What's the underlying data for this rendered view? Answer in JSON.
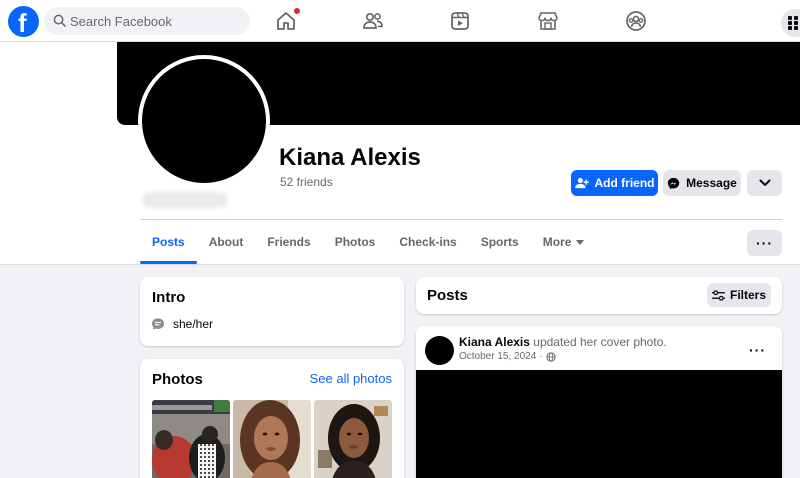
{
  "nav": {
    "logo": "f",
    "search_placeholder": "Search Facebook",
    "icons": [
      "home-icon",
      "friends-icon",
      "watch-icon",
      "marketplace-icon",
      "groups-icon",
      "menu-grid-icon"
    ],
    "notification_color": "#e41e3f"
  },
  "profile": {
    "name": "Kiana Alexis",
    "friends": "52 friends",
    "add_friend": "Add friend",
    "message": "Message"
  },
  "tabs": [
    {
      "label": "Posts",
      "active": true
    },
    {
      "label": "About"
    },
    {
      "label": "Friends"
    },
    {
      "label": "Photos"
    },
    {
      "label": "Check-ins"
    },
    {
      "label": "Sports"
    },
    {
      "label": "More"
    }
  ],
  "intro": {
    "title": "Intro",
    "pronouns": "she/her"
  },
  "photos": {
    "title": "Photos",
    "see_all": "See all photos"
  },
  "posts": {
    "title": "Posts",
    "filters": "Filters"
  },
  "post": {
    "author": "Kiana Alexis",
    "action": "updated her cover photo.",
    "date": "October 15, 2024",
    "separator": "·",
    "audience_icon": "globe-icon"
  },
  "colors": {
    "brand": "#0866ff",
    "background": "#f0f2f5",
    "secondary_text": "#65676b",
    "button_gray": "#e4e6eb"
  }
}
